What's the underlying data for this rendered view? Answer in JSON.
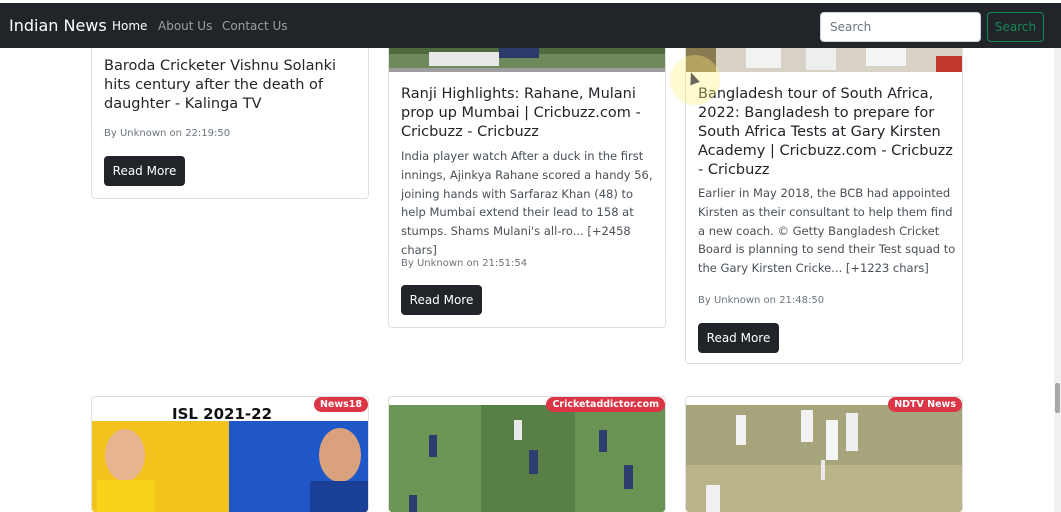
{
  "navbar": {
    "brand": "Indian News",
    "links": [
      {
        "label": "Home"
      },
      {
        "label": "About Us"
      },
      {
        "label": "Contact Us"
      }
    ],
    "search_placeholder": "Search",
    "search_button": "Search"
  },
  "cards_row1": [
    {
      "title": "Baroda Cricketer Vishnu Solanki hits century after the death of daughter - Kalinga TV",
      "meta": "By Unknown on 22:19:50",
      "button": "Read More"
    },
    {
      "title": "Ranji Highlights: Rahane, Mulani prop up Mumbai | Cricbuzz.com - Cricbuzz - Cricbuzz",
      "description": "India player watch After a duck in the first innings, Ajinkya Rahane scored a handy 56, joining hands with Sarfaraz Khan (48) to help Mumbai extend their lead to 158 at stumps. Shams Mulani's all-ro... [+2458 chars]",
      "meta": "By Unknown on 21:51:54",
      "button": "Read More"
    },
    {
      "title": "Bangladesh tour of South Africa, 2022: Bangladesh to prepare for South Africa Tests at Gary Kirsten Academy | Cricbuzz.com - Cricbuzz - Cricbuzz",
      "description": "Earlier in May 2018, the BCB had appointed Kirsten as their consultant to help them find a new coach. © Getty Bangladesh Cricket Board is planning to send their Test squad to the Gary Kirsten Cricke... [+1223 chars]",
      "meta": "By Unknown on 21:48:50",
      "button": "Read More"
    }
  ],
  "cards_row2": [
    {
      "badge": "News18",
      "image_text": "ISL 2021-22"
    },
    {
      "badge": "Cricketaddictor.com"
    },
    {
      "badge": "NDTV News"
    }
  ],
  "colors": {
    "navbar": "#212529",
    "badge": "#dc3545",
    "search_green": "#198754",
    "button_dark": "#212529"
  }
}
